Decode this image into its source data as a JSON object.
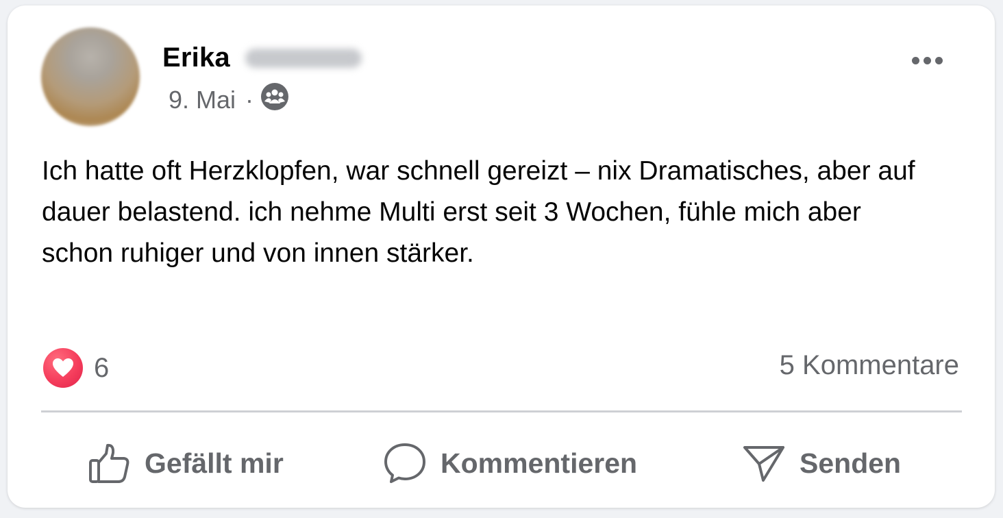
{
  "post": {
    "author_first_name": "Erika",
    "date": "9. Mai",
    "separator": "·",
    "audience_icon": "group-icon",
    "more_icon": "more-horizontal-icon",
    "text": "Ich hatte oft Herzklopfen, war schnell gereizt – nix Dramatisches, aber auf dauer belastend. ich nehme Multi erst seit 3 Wochen, fühle mich aber schon ruhiger und von innen stärker."
  },
  "stats": {
    "reaction_icon": "love-reaction-icon",
    "reaction_count": "6",
    "comments_label": "5 Kommentare"
  },
  "actions": {
    "like": {
      "icon": "thumbs-up-icon",
      "label": "Gefällt mir"
    },
    "comment": {
      "icon": "comment-bubble-icon",
      "label": "Kommentieren"
    },
    "send": {
      "icon": "send-icon",
      "label": "Senden"
    }
  },
  "colors": {
    "text_primary": "#050505",
    "text_secondary": "#65676b",
    "love_red": "#f53d5c",
    "divider": "#ced0d4"
  }
}
